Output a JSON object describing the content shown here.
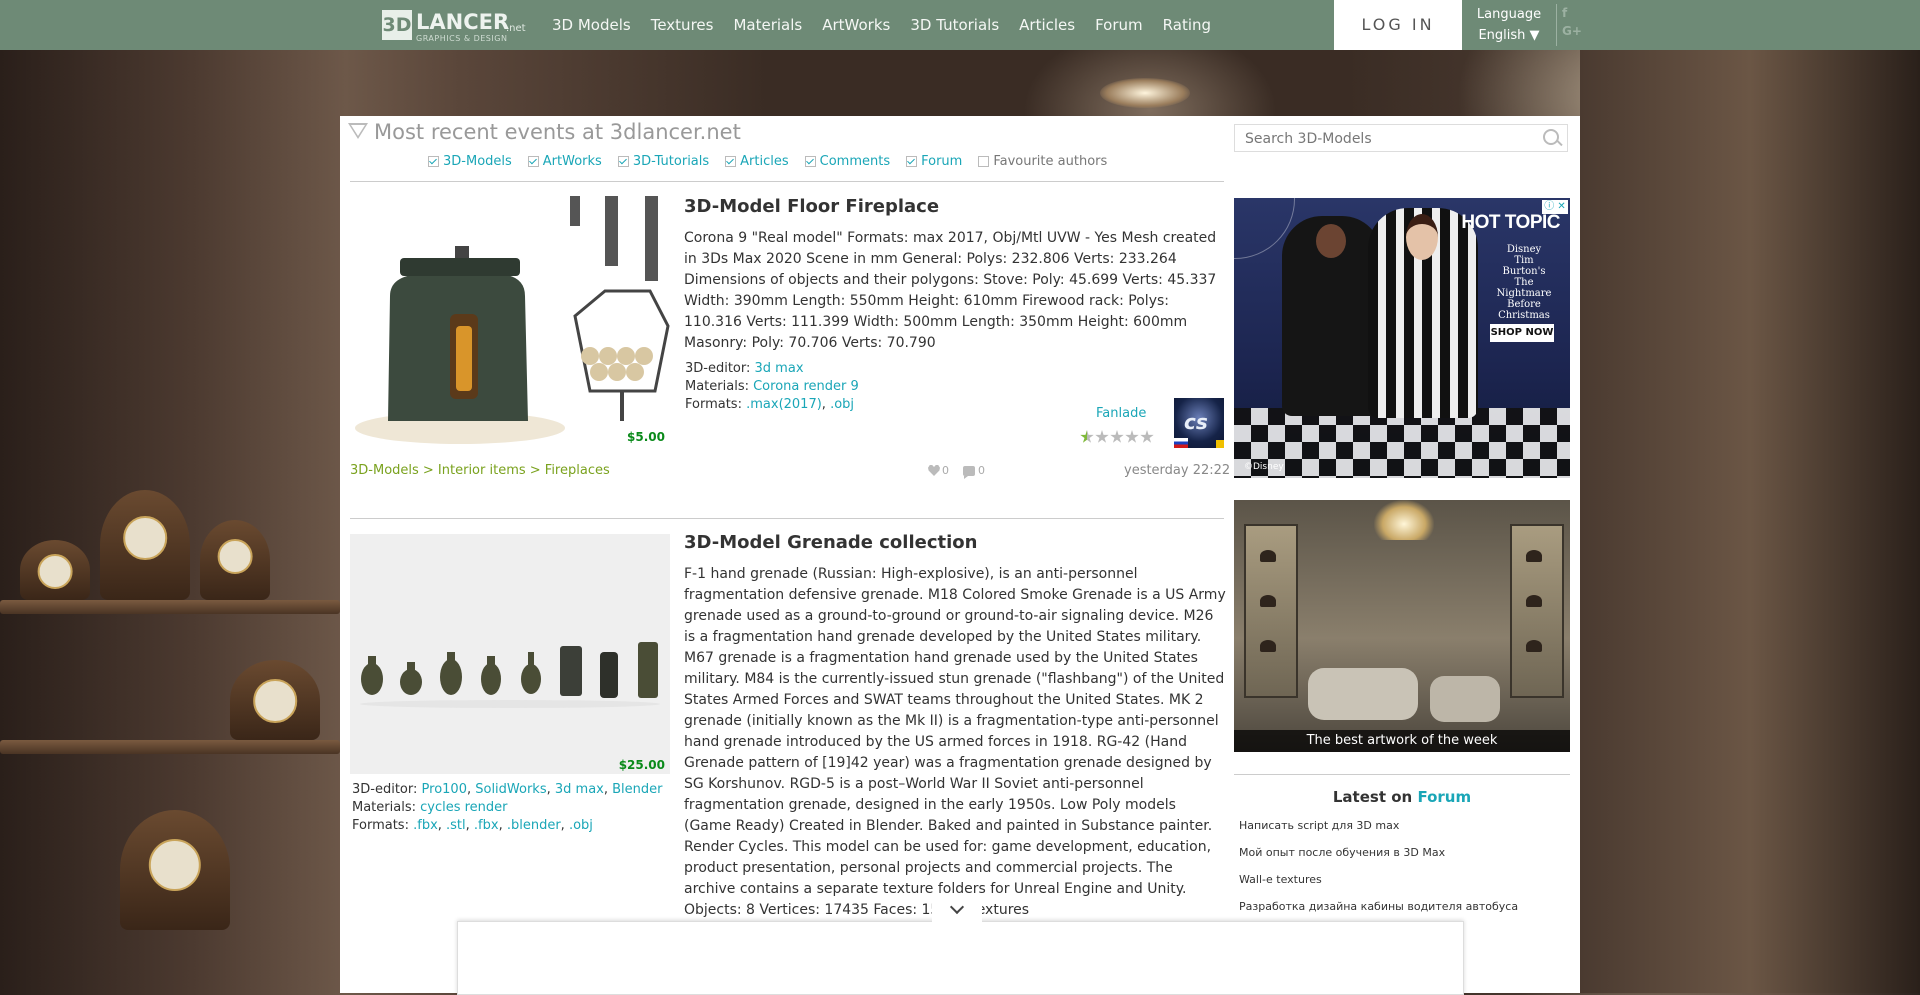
{
  "brand": {
    "logo_mark": "3D",
    "logo_name": "LANCER",
    "logo_tld": ".net",
    "logo_tagline": "GRAPHICS & DESIGN"
  },
  "nav": {
    "items": [
      "3D Models",
      "Textures",
      "Materials",
      "ArtWorks",
      "3D Tutorials",
      "Articles",
      "Forum",
      "Rating"
    ]
  },
  "login_label": "LOG IN",
  "language": {
    "label": "Language",
    "value": "English ▼"
  },
  "social": {
    "facebook": "f",
    "google": "G+"
  },
  "feed": {
    "title": "Most recent events at 3dlancer.net",
    "filters": [
      {
        "label": "3D-Models",
        "checked": true
      },
      {
        "label": "ArtWorks",
        "checked": true
      },
      {
        "label": "3D-Tutorials",
        "checked": true
      },
      {
        "label": "Articles",
        "checked": true
      },
      {
        "label": "Comments",
        "checked": true
      },
      {
        "label": "Forum",
        "checked": true
      },
      {
        "label": "Favourite authors",
        "checked": false
      }
    ]
  },
  "search": {
    "placeholder": "Search 3D-Models"
  },
  "items": [
    {
      "title": "3D-Model Floor Fireplace",
      "description": "Corona 9 \"Real model\" Formats: max 2017, Obj/Mtl UVW - Yes Mesh created in 3Ds Max 2020 Scene in mm General: Polys: 232.806 Verts: 233.264 Dimensions of objects and their polygons: Stove: Poly: 45.699 Verts: 45.337 Width: 390mm Length: 550mm Height: 610mm Firewood rack: Polys: 110.316 Verts: 111.399 Width: 500mm Length: 350mm Height: 600mm Masonry: Poly: 70.706 Verts: 70.790",
      "price": "$5.00",
      "editor_label": "3D-editor:",
      "editors": [
        "3d max"
      ],
      "materials_label": "Materials:",
      "materials": [
        "Corona render 9"
      ],
      "formats_label": "Formats:",
      "formats": [
        ".max(2017)",
        ".obj"
      ],
      "author": "Fanlade",
      "rating": 0.5,
      "breadcrumb": "3D-Models > Interior items > Fireplaces",
      "likes": "0",
      "comments": "0",
      "time": "yesterday 22:22"
    },
    {
      "title": "3D-Model Grenade collection",
      "description": "F-1 hand grenade (Russian: High-explosive), is an anti-personnel fragmentation defensive grenade. M18 Colored Smoke Grenade is a US Army grenade used as a ground-to-ground or ground-to-air signaling device. M26 is a fragmentation hand grenade developed by the United States military. M67 grenade is a fragmentation hand grenade used by the United States military. M84 is the currently-issued stun grenade (\"flashbang\") of the United States Armed Forces and SWAT teams throughout the United States. MK 2 grenade (initially known as the Mk II) is a fragmentation-type anti-personnel hand grenade introduced by the US armed forces in 1918. RG-42 (Hand Grenade pattern of [19]42 year) was a fragmentation grenade designed by SG Korshunov. RGD-5 is a post–World War II Soviet anti-personnel fragmentation grenade, designed in the early 1950s. Low Poly models (Game Ready) Created in Blender. Baked and painted in Substance painter. Render Cycles. This model can be used for: game development, education, product presentation, personal projects and commercial projects. The archive contains a separate texture folders for Unreal Engine and Unity. Objects: 8 Vertices: 17435 Faces: 15388 Textures",
      "price": "$25.00",
      "editor_label": "3D-editor:",
      "editors": [
        "Pro100",
        "SolidWorks",
        "3d max",
        "Blender"
      ],
      "materials_label": "Materials:",
      "materials": [
        "cycles render"
      ],
      "formats_label": "Formats:",
      "formats": [
        ".fbx",
        ".stl",
        ".fbx",
        ".blender",
        ".obj"
      ]
    }
  ],
  "ad": {
    "brand": "HOT TOPIC",
    "subtitle": "Disney Tim Burton's The Nightmare Before Christmas",
    "cta": "SHOP NOW",
    "copyright": "©Disney",
    "controls": "ⓘ ✕"
  },
  "artwork": {
    "caption": "The best artwork of the week"
  },
  "forum": {
    "heading_prefix": "Latest on",
    "heading_link": "Forum",
    "topics": [
      "Написать script для 3D max",
      "Мой опыт после обучения в 3D Max",
      "Wall-e textures",
      "Разработка дизайна кабины водителя автобуса"
    ]
  },
  "colors": {
    "nav_bg": "#6e8a76",
    "link": "#1aa6b7",
    "price": "#0a8a1a",
    "breadcrumb": "#7aa21e"
  },
  "icons": [
    "search-icon",
    "heart-icon",
    "comment-icon",
    "chevron-down-icon",
    "filter-triangle-icon",
    "star-icon"
  ]
}
